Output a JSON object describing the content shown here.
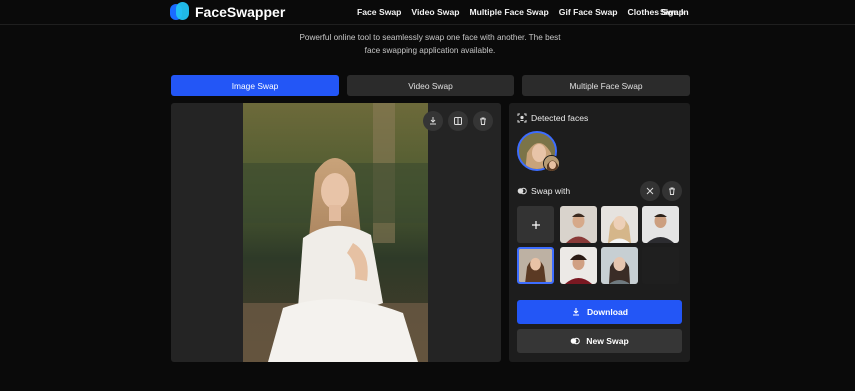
{
  "brand": {
    "name": "FaceSwapper"
  },
  "nav": {
    "links": [
      "Face Swap",
      "Video Swap",
      "Multiple Face Swap",
      "Gif Face Swap",
      "Clothes Swap"
    ],
    "signin": "Sign In"
  },
  "hero": {
    "line1": "Powerful online tool to seamlessly swap one face with another. The best",
    "line2": "face swapping application available."
  },
  "tabs": [
    {
      "label": "Image Swap",
      "active": true
    },
    {
      "label": "Video Swap",
      "active": false
    },
    {
      "label": "Multiple Face Swap",
      "active": false
    }
  ],
  "editor": {
    "toolbar_icons": [
      "download-icon",
      "compare-icon",
      "trash-icon"
    ]
  },
  "panel": {
    "detected_title": "Detected faces",
    "swap_title": "Swap with",
    "download_label": "Download",
    "new_swap_label": "New Swap"
  },
  "colors": {
    "accent": "#2356f6",
    "selected_border": "#3d6dff",
    "background": "#0a0a0a"
  }
}
